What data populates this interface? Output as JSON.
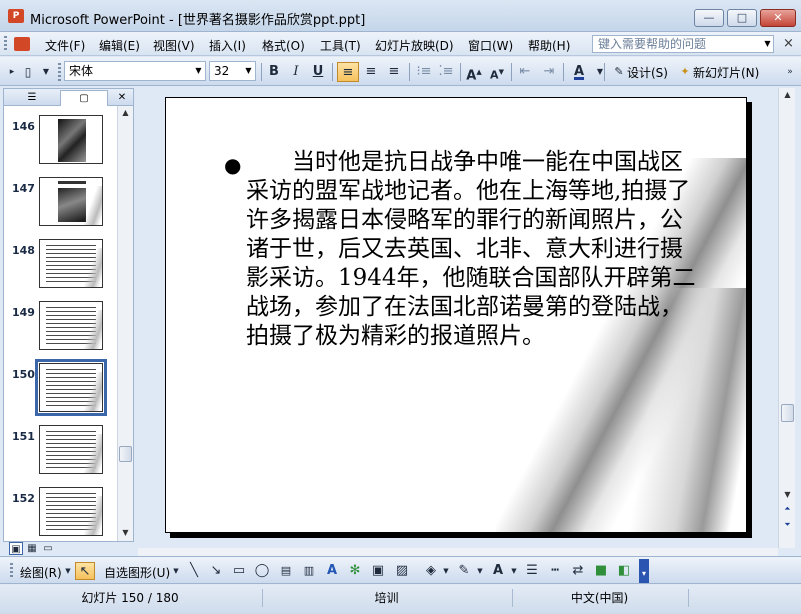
{
  "window": {
    "app_name": "Microsoft PowerPoint",
    "title": "Microsoft PowerPoint - [世界著名摄影作品欣赏ppt.ppt]",
    "minimize": "—",
    "maximize": "□",
    "close": "✕"
  },
  "menu": {
    "items": [
      "文件(F)",
      "编辑(E)",
      "视图(V)",
      "插入(I)",
      "格式(O)",
      "工具(T)",
      "幻灯片放映(D)",
      "窗口(W)",
      "帮助(H)"
    ],
    "help_placeholder": "键入需要帮助的问题",
    "close_doc": "×"
  },
  "format_toolbar": {
    "font": "宋体",
    "font_size": "32",
    "bold": "B",
    "italic": "I",
    "underline": "U",
    "design_label": "设计(S)",
    "new_slide_label": "新幻灯片(N)"
  },
  "slides_panel": {
    "tabs": [
      "outline",
      "slides"
    ],
    "close": "✕",
    "thumbnails": [
      {
        "number": "146",
        "kind": "photo"
      },
      {
        "number": "147",
        "kind": "photo-caption"
      },
      {
        "number": "148",
        "kind": "text"
      },
      {
        "number": "149",
        "kind": "text"
      },
      {
        "number": "150",
        "kind": "text",
        "selected": true
      },
      {
        "number": "151",
        "kind": "text"
      },
      {
        "number": "152",
        "kind": "text"
      }
    ]
  },
  "slide": {
    "bullet": "●",
    "text": "当时他是抗日战争中唯一能在中国战区采访的盟军战地记者。他在上海等地,拍摄了许多揭露日本侵略军的罪行的新闻照片，公诸于世，后又去英国、北非、意大利进行摄影采访。1944年，他随联合国部队开辟第二战场，参加了在法国北部诺曼第的登陆战，拍摄了极为精彩的报道照片。"
  },
  "draw_toolbar": {
    "draw_label": "绘图(R)",
    "autoshape_label": "自选图形(U)"
  },
  "status": {
    "slide_info": "幻灯片 150 / 180",
    "design": "培训",
    "language": "中文(中国)"
  }
}
